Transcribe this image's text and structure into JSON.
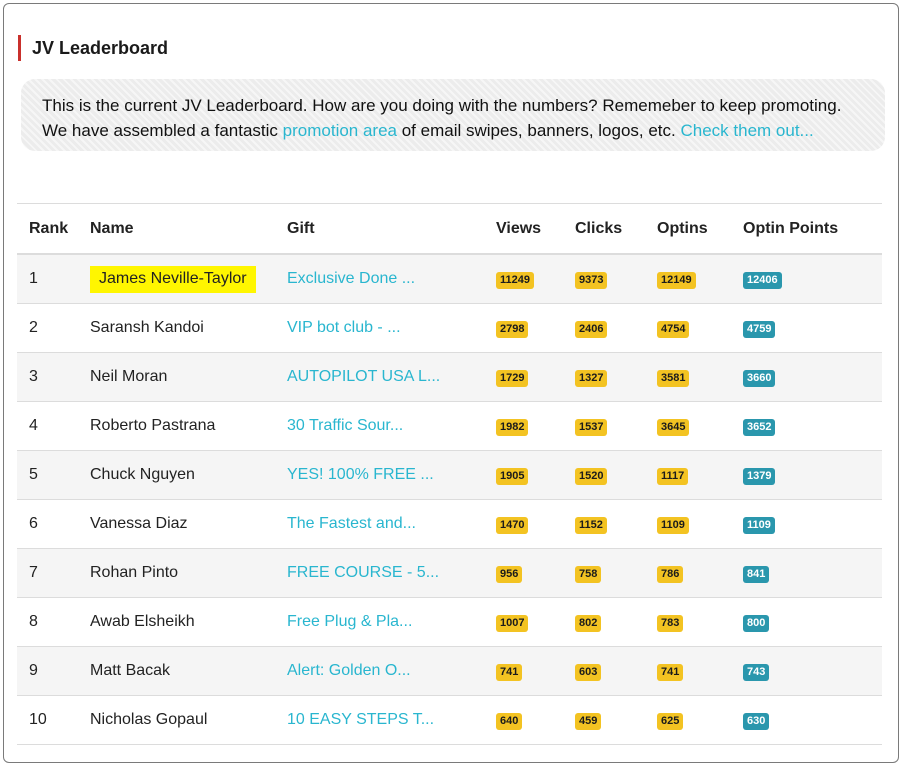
{
  "section": {
    "title": "JV Leaderboard"
  },
  "notice": {
    "text_before": "This is the current JV Leaderboard. How are you doing with the numbers? Rememeber to keep promoting. We have assembled a fantastic ",
    "link1": "promotion area",
    "text_middle": " of email swipes, banners, logos, etc. ",
    "link2": "Check them out..."
  },
  "table": {
    "headers": [
      "Rank",
      "Name",
      "Gift",
      "Views",
      "Clicks",
      "Optins",
      "Optin Points"
    ],
    "rows": [
      {
        "rank": "1",
        "name": "James Neville-Taylor",
        "gift": "Exclusive Done ...",
        "views": "11249",
        "clicks": "9373",
        "optins": "12149",
        "points": "12406",
        "highlighted": true
      },
      {
        "rank": "2",
        "name": "Saransh Kandoi",
        "gift": "VIP bot club - ...",
        "views": "2798",
        "clicks": "2406",
        "optins": "4754",
        "points": "4759"
      },
      {
        "rank": "3",
        "name": "Neil Moran",
        "gift": "AUTOPILOT USA L...",
        "views": "1729",
        "clicks": "1327",
        "optins": "3581",
        "points": "3660"
      },
      {
        "rank": "4",
        "name": "Roberto Pastrana",
        "gift": "30 Traffic Sour...",
        "views": "1982",
        "clicks": "1537",
        "optins": "3645",
        "points": "3652"
      },
      {
        "rank": "5",
        "name": "Chuck Nguyen",
        "gift": "YES! 100% FREE ...",
        "views": "1905",
        "clicks": "1520",
        "optins": "1117",
        "points": "1379"
      },
      {
        "rank": "6",
        "name": "Vanessa Diaz",
        "gift": "The Fastest and...",
        "views": "1470",
        "clicks": "1152",
        "optins": "1109",
        "points": "1109"
      },
      {
        "rank": "7",
        "name": "Rohan Pinto",
        "gift": "FREE COURSE - 5...",
        "views": "956",
        "clicks": "758",
        "optins": "786",
        "points": "841"
      },
      {
        "rank": "8",
        "name": "Awab Elsheikh",
        "gift": "Free Plug & Pla...",
        "views": "1007",
        "clicks": "802",
        "optins": "783",
        "points": "800"
      },
      {
        "rank": "9",
        "name": "Matt Bacak",
        "gift": "Alert: Golden O...",
        "views": "741",
        "clicks": "603",
        "optins": "741",
        "points": "743"
      },
      {
        "rank": "10",
        "name": "Nicholas Gopaul",
        "gift": "10 EASY STEPS T...",
        "views": "640",
        "clicks": "459",
        "optins": "625",
        "points": "630"
      }
    ]
  },
  "colors": {
    "accent_bar": "#c9302c",
    "link": "#29b6cf",
    "badge_yellow": "#f3c322",
    "badge_teal": "#2a97ad",
    "highlight": "#fff600"
  }
}
